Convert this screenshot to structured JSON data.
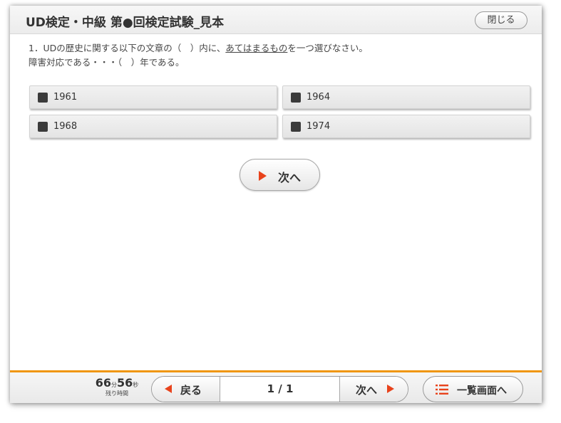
{
  "header": {
    "title": "UD検定・中級 第●回検定試験_見本",
    "close_label": "閉じる"
  },
  "question": {
    "prefix": "1．UDの歴史に関する以下の文章の（　）内に、",
    "underlined": "あてはまるもの",
    "suffix": "を一つ選びなさい。",
    "line2": "障害対応である・・・（　）年である。"
  },
  "options": [
    {
      "label": "1961"
    },
    {
      "label": "1964"
    },
    {
      "label": "1968"
    },
    {
      "label": "1974"
    }
  ],
  "next_button": {
    "label": "次へ"
  },
  "footer": {
    "timer": {
      "minutes": "66",
      "minutes_unit": "分",
      "seconds": "56",
      "seconds_unit": "秒",
      "caption": "残り時間"
    },
    "back_label": "戻る",
    "page_indicator": "1 / 1",
    "forward_label": "次へ",
    "list_label": "一覧画面へ"
  },
  "colors": {
    "accent": "#f0960f",
    "arrow": "#e8431c"
  },
  "icons": {
    "close": "none",
    "next": "play-arrow-icon",
    "back": "back-arrow-icon",
    "list": "list-icon"
  }
}
